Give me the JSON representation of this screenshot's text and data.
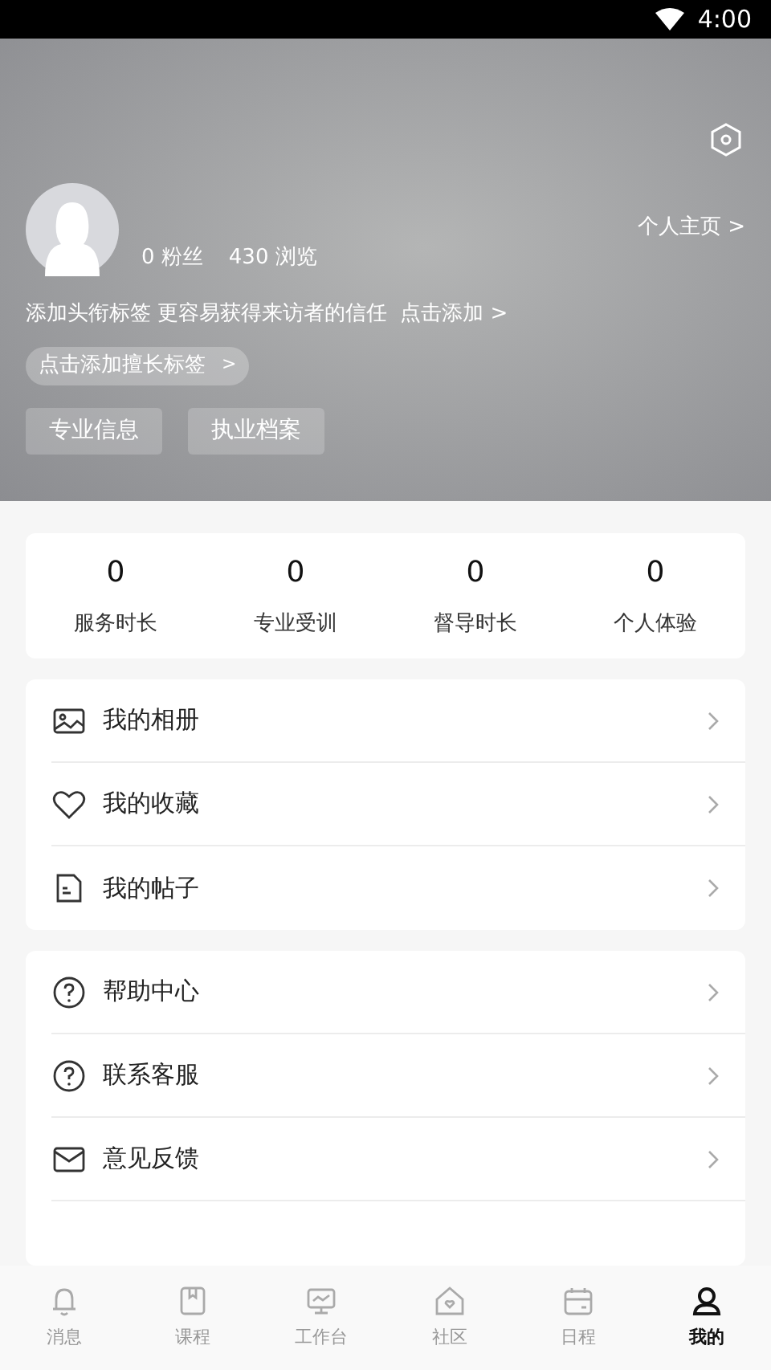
{
  "status_bar": {
    "time": "4:00"
  },
  "profile": {
    "fans": "0 粉丝",
    "views": "430 浏览",
    "homepage_link": "个人主页 >",
    "headline_hint": "添加头衔标签 更容易获得来访者的信任",
    "headline_add": "点击添加 >",
    "skill_tag_button": "点击添加擅长标签",
    "skill_tag_arrow": ">",
    "buttons": [
      "专业信息",
      "执业档案"
    ]
  },
  "stats": [
    {
      "value": "0",
      "label": "服务时长"
    },
    {
      "value": "0",
      "label": "专业受训"
    },
    {
      "value": "0",
      "label": "督导时长"
    },
    {
      "value": "0",
      "label": "个人体验"
    }
  ],
  "menu_groups": [
    [
      {
        "kind": "album",
        "label": "我的相册"
      },
      {
        "kind": "favorite",
        "label": "我的收藏"
      },
      {
        "kind": "posts",
        "label": "我的帖子"
      }
    ],
    [
      {
        "kind": "help",
        "label": "帮助中心"
      },
      {
        "kind": "help",
        "label": "联系客服"
      },
      {
        "kind": "mail",
        "label": "意见反馈"
      }
    ]
  ],
  "tab_bar": [
    {
      "kind": "bell",
      "label": "消息",
      "selected": false
    },
    {
      "kind": "book",
      "label": "课程",
      "selected": false
    },
    {
      "kind": "monitor",
      "label": "工作台",
      "selected": false
    },
    {
      "kind": "home",
      "label": "社区",
      "selected": false
    },
    {
      "kind": "calendar",
      "label": "日程",
      "selected": false
    },
    {
      "kind": "person",
      "label": "我的",
      "selected": true
    }
  ]
}
